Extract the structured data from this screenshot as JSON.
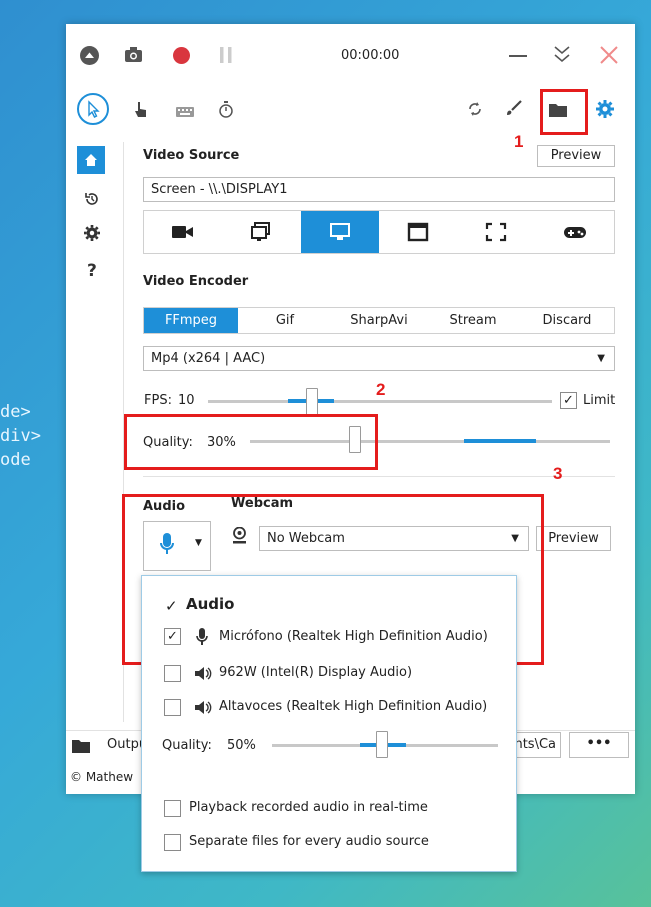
{
  "titlebar": {
    "timer": "00:00:00"
  },
  "annotations": {
    "label1": "1",
    "label2": "2",
    "label3": "3"
  },
  "sidebar": {
    "help": "?"
  },
  "video_source": {
    "heading": "Video Source",
    "preview": "Preview",
    "screen": "Screen - \\\\.\\DISPLAY1"
  },
  "video_encoder": {
    "heading": "Video Encoder",
    "tabs": [
      "FFmpeg",
      "Gif",
      "SharpAvi",
      "Stream",
      "Discard"
    ],
    "active_tab": "FFmpeg",
    "format": "Mp4 (x264 | AAC)",
    "fps_label": "FPS:",
    "fps_value": "10",
    "limit_label": "Limit",
    "quality_label": "Quality:",
    "quality_value": "30%",
    "quality_level": 0.3
  },
  "audio": {
    "heading": "Audio"
  },
  "webcam": {
    "heading": "Webcam",
    "selected": "No Webcam",
    "preview": "Preview"
  },
  "output": {
    "label": "Outpu",
    "path_tail": "ents\\Ca",
    "more": "•••"
  },
  "footer": {
    "text": "© Mathew"
  },
  "audio_popup": {
    "header": "Audio",
    "sources": [
      {
        "label": "Micrófono (Realtek High Definition Audio)",
        "checked": true
      },
      {
        "label": "962W (Intel(R) Display Audio)",
        "checked": false
      },
      {
        "label": "Altavoces (Realtek High Definition Audio)",
        "checked": false
      }
    ],
    "quality_label": "Quality:",
    "quality_value": "50%",
    "quality_level": 0.5,
    "playback": "Playback recorded audio in real-time",
    "separate": "Separate files for every audio source"
  },
  "colors": {
    "accent": "#1e8fd8",
    "highlight": "#e41c1c",
    "record": "#d9363e"
  }
}
